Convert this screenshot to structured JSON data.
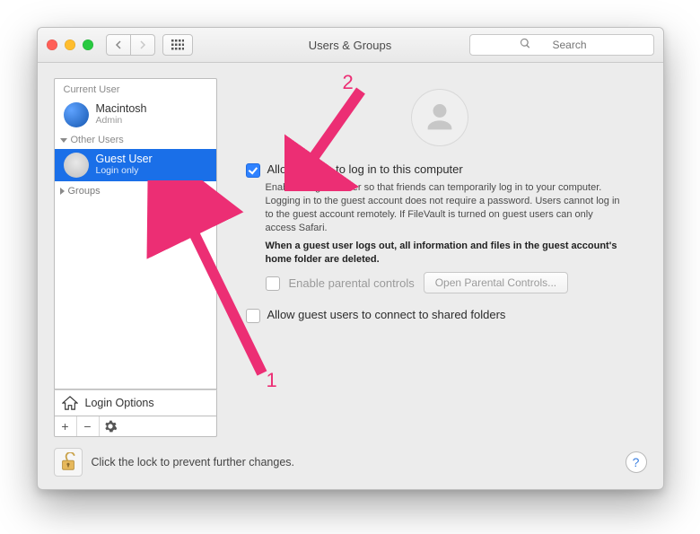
{
  "window": {
    "title": "Users & Groups",
    "search_placeholder": "Search"
  },
  "sidebar": {
    "current_user_label": "Current User",
    "current_user": {
      "name": "Macintosh",
      "role": "Admin"
    },
    "other_users_label": "Other Users",
    "other_users": [
      {
        "name": "Guest User",
        "role": "Login only"
      }
    ],
    "groups_label": "Groups",
    "login_options_label": "Login Options"
  },
  "detail": {
    "allow_guest_label": "Allow guests to log in to this computer",
    "allow_guest_checked": true,
    "desc_1": "Enable the guest user so that friends can temporarily log in to your computer. Logging in to the guest account does not require a password. Users cannot log in to the guest account remotely. If FileVault is turned on guest users can only access Safari.",
    "desc_2": "When a guest user logs out, all information and files in the guest account's home folder are deleted.",
    "parental_label": "Enable parental controls",
    "parental_button": "Open Parental Controls...",
    "shared_folders_label": "Allow guest users to connect to shared folders"
  },
  "footer": {
    "lock_text": "Click the lock to prevent further changes."
  },
  "annotations": {
    "label_1": "1",
    "label_2": "2"
  }
}
